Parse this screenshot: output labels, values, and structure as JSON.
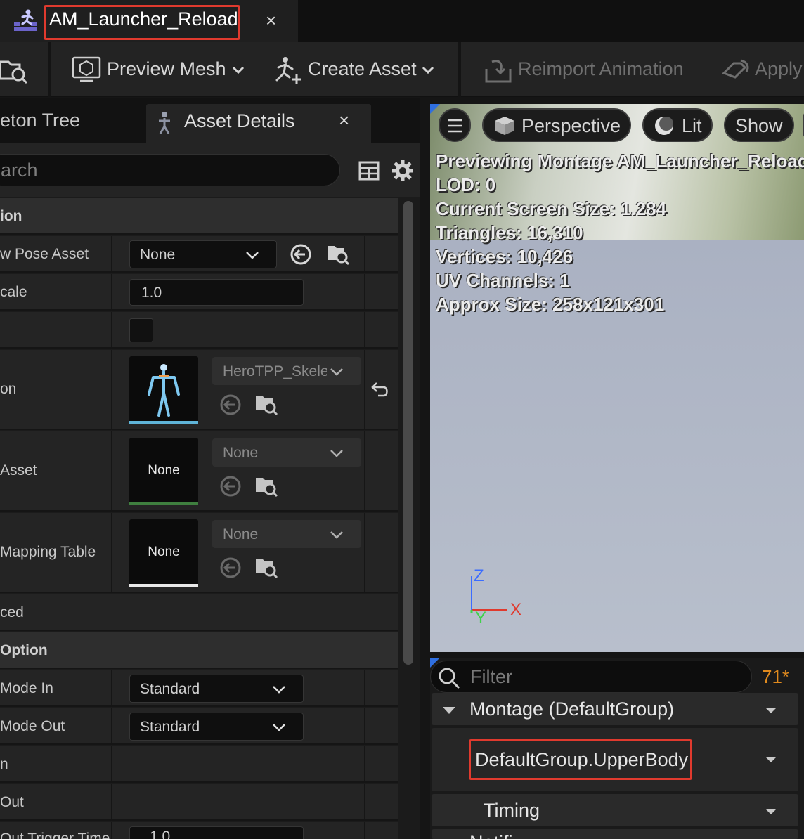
{
  "document_tab": {
    "title": "AM_Launcher_Reload",
    "close": "×"
  },
  "toolbar": {
    "preview_mesh": "Preview Mesh",
    "create_asset": "Create Asset",
    "reimport_animation": "Reimport Animation",
    "apply": "Apply"
  },
  "left_panel": {
    "tabs": [
      {
        "label": "eton Tree"
      },
      {
        "label": "Asset Details",
        "close": "×"
      }
    ],
    "search_placeholder": "arch",
    "rows": [
      {
        "label": "ion"
      },
      {
        "label": "w Pose Asset",
        "value": "None"
      },
      {
        "label": "cale",
        "value": "1.0"
      },
      {
        "label": "",
        "checked": false
      },
      {
        "label": "on",
        "value": "HeroTPP_Skele"
      },
      {
        "label": "Asset",
        "thumb": "None",
        "value": "None"
      },
      {
        "label": "Mapping Table",
        "thumb": "None",
        "value": "None"
      },
      {
        "label": "ced"
      },
      {
        "label": "Option"
      },
      {
        "label": "Mode In",
        "value": "Standard"
      },
      {
        "label": "Mode Out",
        "value": "Standard"
      },
      {
        "label": "n"
      },
      {
        "label": "Out"
      },
      {
        "label": "Out Trigger Time",
        "value": "1.0"
      }
    ]
  },
  "viewport": {
    "buttons": {
      "perspective": "Perspective",
      "lit": "Lit",
      "show": "Show"
    },
    "info": [
      "Previewing Montage AM_Launcher_Reload",
      "LOD: 0",
      "Current Screen Size: 1.284",
      "Triangles: 16,310",
      "Vertices: 10,426",
      "UV Channels: 1",
      "Approx Size: 258x121x301"
    ],
    "axes": {
      "z": "Z",
      "x": "X",
      "y": "Y"
    },
    "colors": {
      "z_axis": "#3b6cff",
      "x_axis": "#e03a2e",
      "y_axis": "#3fd24a"
    }
  },
  "notify_panel": {
    "filter_placeholder": "Filter",
    "count": "71*",
    "tree": [
      {
        "label": "Montage (DefaultGroup)"
      },
      {
        "label": "DefaultGroup.UpperBody"
      },
      {
        "label": "Timing"
      },
      {
        "label": "Notifi"
      }
    ]
  },
  "colors": {
    "highlight": "#e03a2e",
    "accent_count": "#e08a1e"
  }
}
